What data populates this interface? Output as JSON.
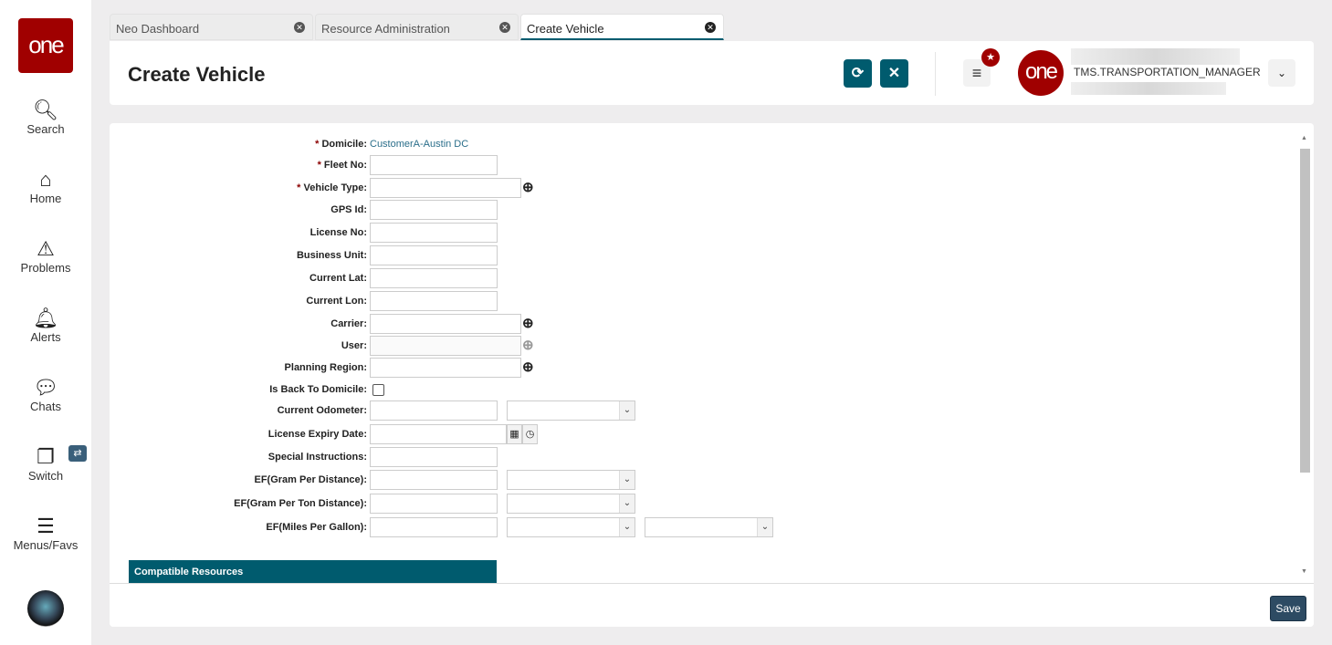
{
  "sidebar": {
    "logo": "one",
    "items": [
      {
        "label": "Search",
        "icon": "search-icon"
      },
      {
        "label": "Home",
        "icon": "home-icon"
      },
      {
        "label": "Problems",
        "icon": "warning-icon"
      },
      {
        "label": "Alerts",
        "icon": "bell-icon"
      },
      {
        "label": "Chats",
        "icon": "chat-icon"
      },
      {
        "label": "Switch",
        "icon": "switch-icon"
      },
      {
        "label": "Menus/Favs",
        "icon": "menu-icon"
      }
    ]
  },
  "tabs": [
    {
      "label": "Neo Dashboard"
    },
    {
      "label": "Resource Administration"
    },
    {
      "label": "Create Vehicle",
      "active": true
    }
  ],
  "header": {
    "title": "Create Vehicle",
    "user_role": "TMS.TRANSPORTATION_MANAGER",
    "user_logo": "one"
  },
  "form": {
    "fields": [
      {
        "label": "Domicile",
        "required": true,
        "type": "value",
        "value": "CustomerA-Austin DC"
      },
      {
        "label": "Fleet No",
        "required": true,
        "type": "text"
      },
      {
        "label": "Vehicle Type",
        "required": true,
        "type": "lookup"
      },
      {
        "label": "GPS Id",
        "type": "text"
      },
      {
        "label": "License No",
        "type": "text"
      },
      {
        "label": "Business Unit",
        "type": "text"
      },
      {
        "label": "Current Lat",
        "type": "text"
      },
      {
        "label": "Current Lon",
        "type": "text"
      },
      {
        "label": "Carrier",
        "type": "lookup"
      },
      {
        "label": "User",
        "type": "lookup",
        "disabled": true
      },
      {
        "label": "Planning Region",
        "type": "lookup"
      },
      {
        "label": "Is Back To Domicile",
        "type": "checkbox",
        "checked": false
      },
      {
        "label": "Current Odometer",
        "type": "text+select"
      },
      {
        "label": "License Expiry Date",
        "type": "date"
      },
      {
        "label": "Special Instructions",
        "type": "text"
      },
      {
        "label": "EF(Gram Per Distance)",
        "type": "text+select"
      },
      {
        "label": "EF(Gram Per Ton Distance)",
        "type": "text+select"
      },
      {
        "label": "EF(Miles Per Gallon)",
        "type": "text+select+select"
      }
    ]
  },
  "section": {
    "title": "Compatible Resources"
  },
  "footer": {
    "save_label": "Save"
  },
  "colors": {
    "accent": "#005b6e",
    "brand": "#a00000"
  }
}
